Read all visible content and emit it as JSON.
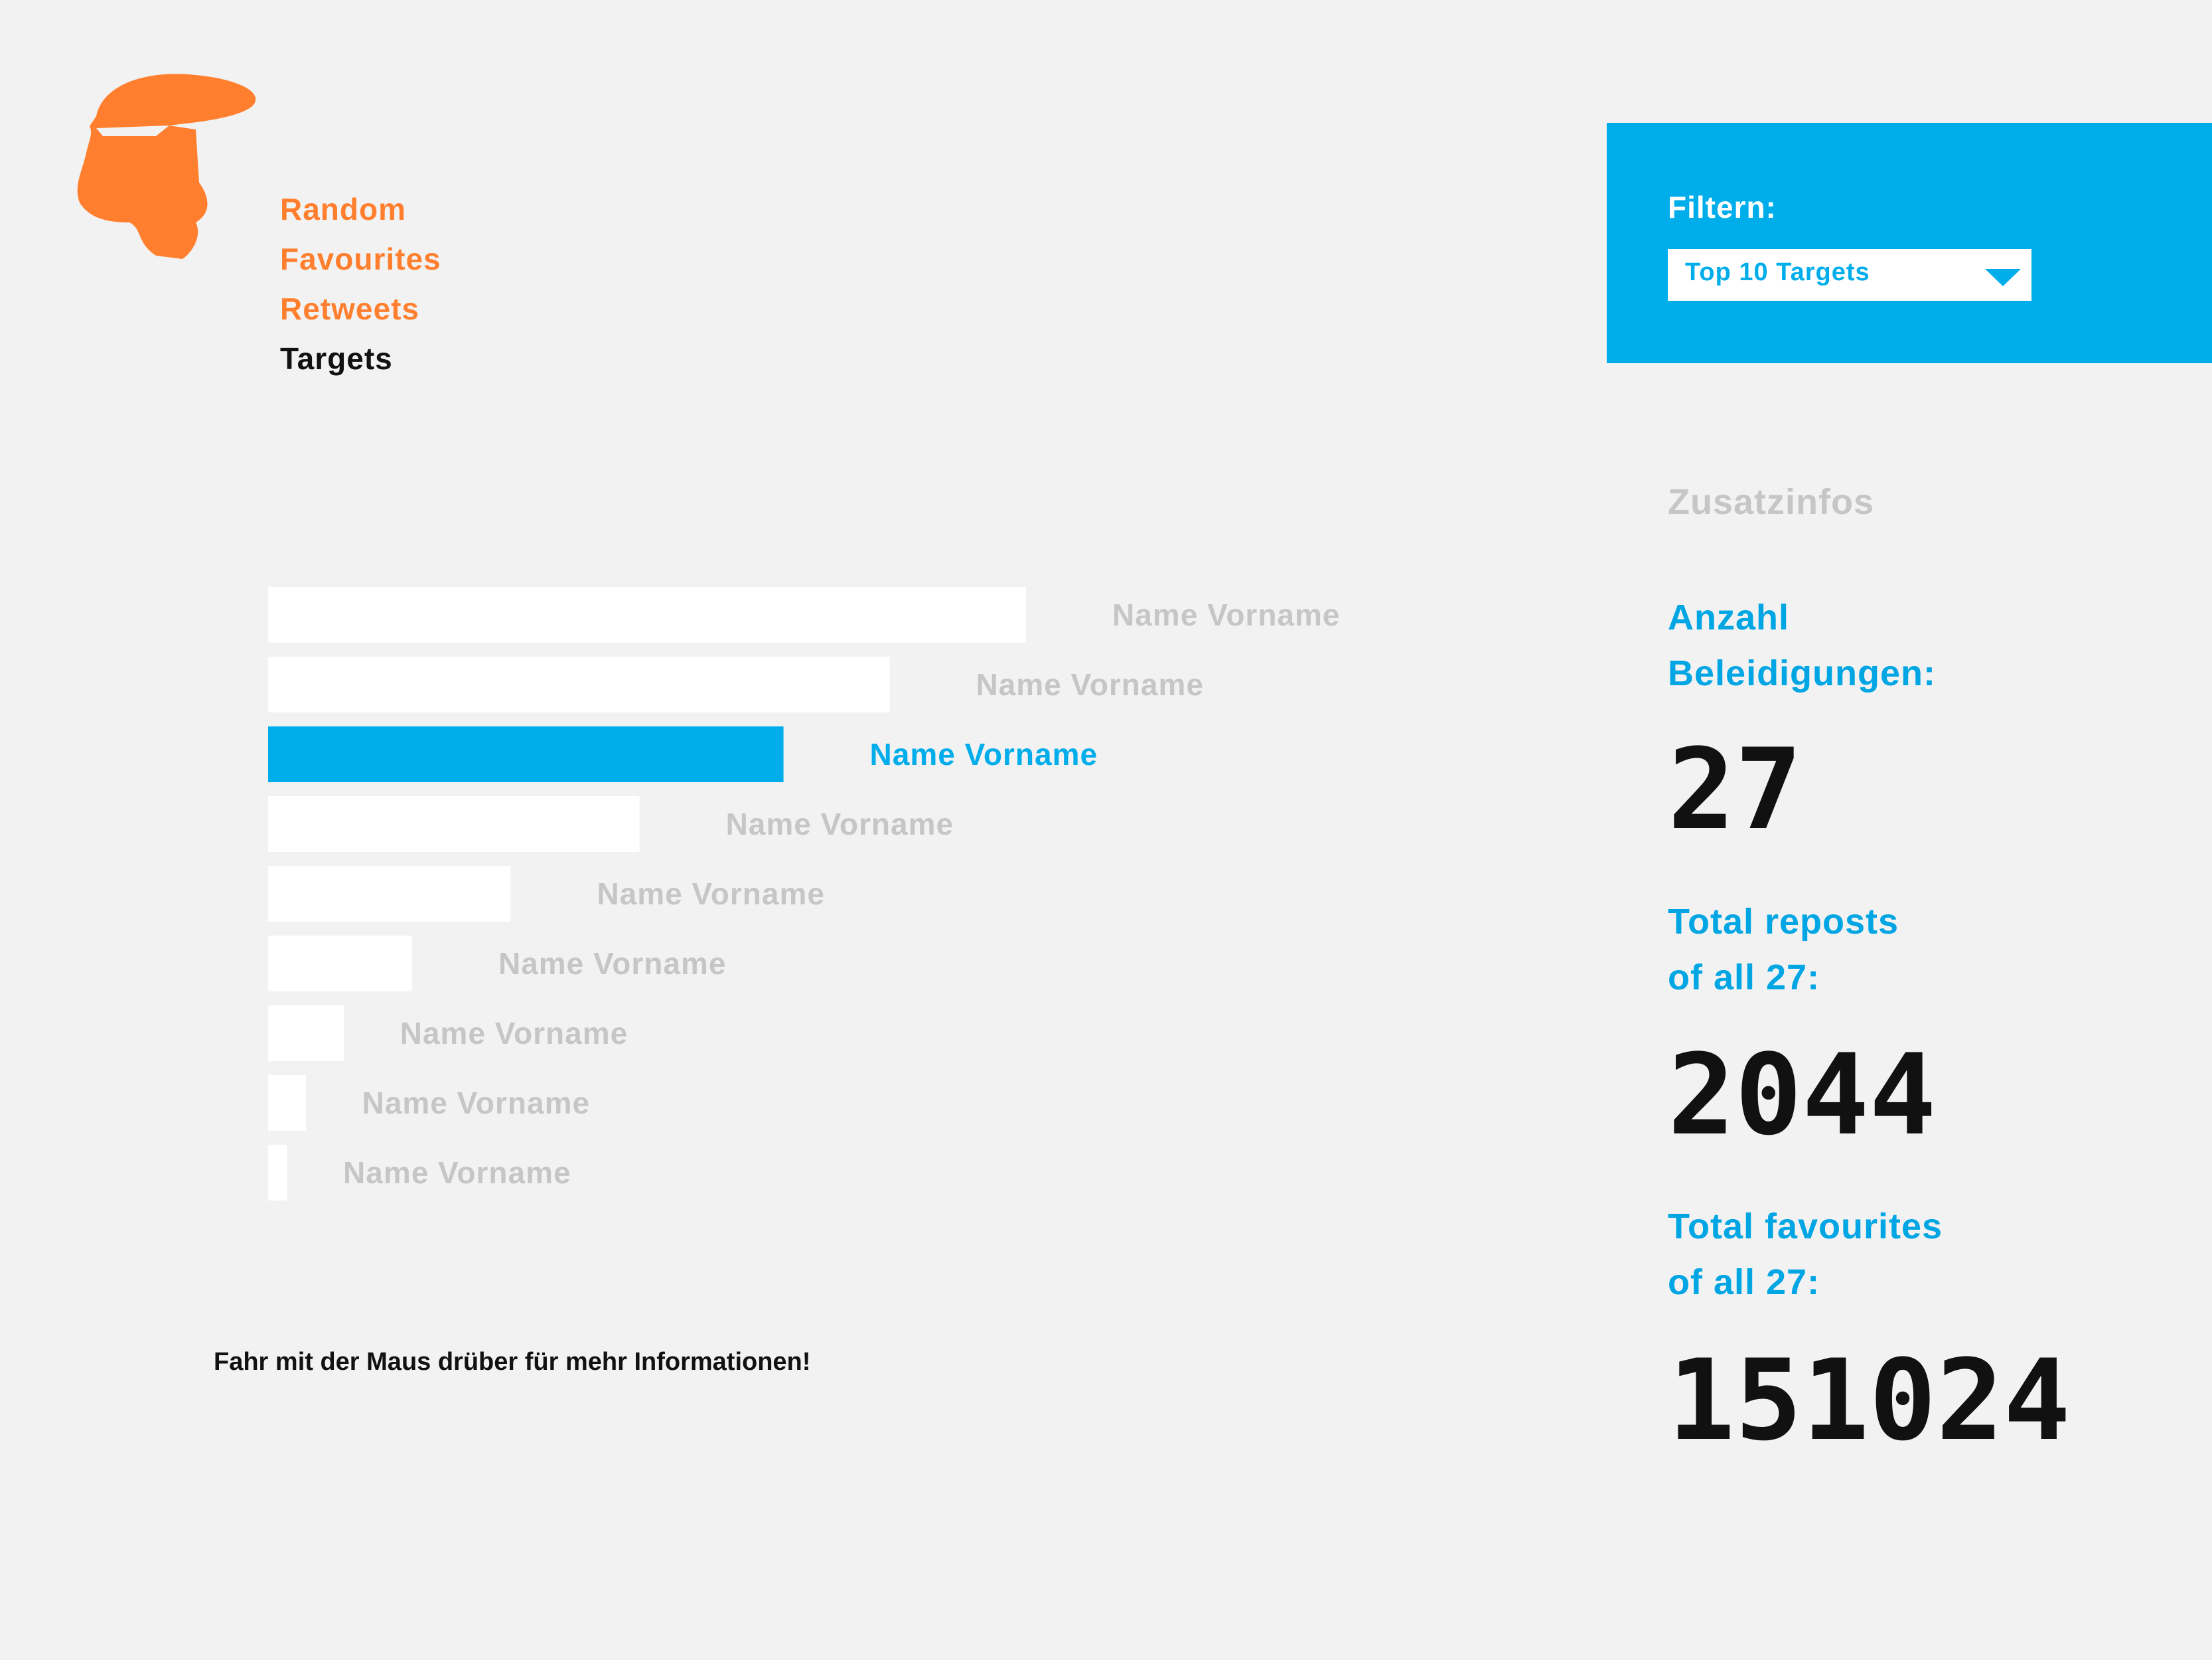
{
  "nav": {
    "items": [
      {
        "label": "Random",
        "active": false
      },
      {
        "label": "Favourites",
        "active": false
      },
      {
        "label": "Retweets",
        "active": false
      },
      {
        "label": "Targets",
        "active": true
      }
    ]
  },
  "filter": {
    "label": "Filtern:",
    "selected": "Top 10 Targets"
  },
  "sidebar": {
    "heading": "Zusatzinfos",
    "stats": [
      {
        "label_line1": "Anzahl",
        "label_line2": "Beleidigungen:",
        "value": "27"
      },
      {
        "label_line1": "Total reposts",
        "label_line2": "of all 27:",
        "value": "2044"
      },
      {
        "label_line1": "Total favourites",
        "label_line2": "of all 27:",
        "value": "151024"
      }
    ]
  },
  "hint": "Fahr mit der Maus drüber für mehr Informationen!",
  "colors": {
    "accent": "#00adeb",
    "brand": "#ff7f2e",
    "bar": "#ffffff",
    "label_muted": "#c6c6c6"
  },
  "chart_data": {
    "type": "bar",
    "orientation": "horizontal",
    "categories": [
      "Name Vorname",
      "Name Vorname",
      "Name Vorname",
      "Name Vorname",
      "Name Vorname",
      "Name Vorname",
      "Name Vorname",
      "Name Vorname",
      "Name Vorname"
    ],
    "values": [
      100,
      82,
      68,
      49,
      32,
      19,
      10,
      5,
      2.5
    ],
    "highlighted_index": 2,
    "title": "",
    "xlabel": "",
    "ylabel": "",
    "grid": false
  }
}
